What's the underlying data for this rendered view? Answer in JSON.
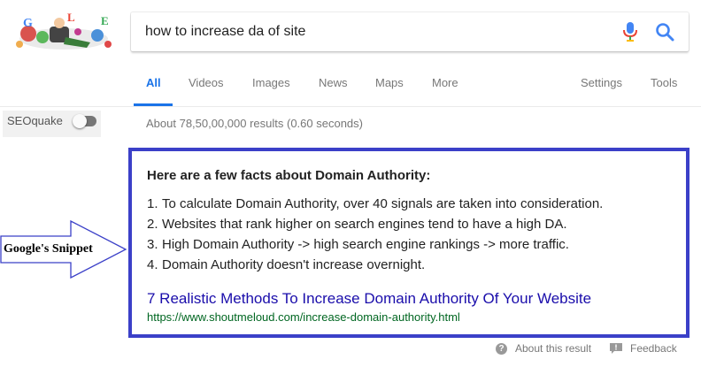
{
  "logo": {
    "letters": [
      "G",
      "L",
      "E"
    ]
  },
  "search": {
    "query": "how to increase da of site"
  },
  "tabs": {
    "left": [
      {
        "label": "All",
        "active": true
      },
      {
        "label": "Videos"
      },
      {
        "label": "Images"
      },
      {
        "label": "News"
      },
      {
        "label": "Maps"
      },
      {
        "label": "More"
      }
    ],
    "right": [
      {
        "label": "Settings"
      },
      {
        "label": "Tools"
      }
    ]
  },
  "seoquake": {
    "label": "SEOquake",
    "enabled": false
  },
  "result_stats": "About 78,50,00,000 results (0.60 seconds)",
  "snippet": {
    "heading": "Here are a few facts about Domain Authority:",
    "items": [
      {
        "num": "1.",
        "text": "To calculate Domain Authority, over 40 signals are taken into consideration."
      },
      {
        "num": "2.",
        "text": "Websites that rank higher on search engines tend to have a high DA."
      },
      {
        "num": "3.",
        "text": "High Domain Authority -> high search engine rankings -> more traffic."
      },
      {
        "num": "4.",
        "text": "Domain Authority doesn't increase overnight."
      }
    ],
    "link_title": "7 Realistic Methods To Increase Domain Authority Of Your Website",
    "url": "https://www.shoutmeloud.com/increase-domain-authority.html"
  },
  "footer": {
    "about_label": "About this result",
    "about_icon_glyph": "?",
    "feedback_label": "Feedback"
  },
  "annotation": {
    "label": "Google's Snippet"
  },
  "colors": {
    "accent": "#1a73e8",
    "link": "#1a0dab",
    "url": "#006621",
    "snippet_border": "#3b40c8"
  }
}
